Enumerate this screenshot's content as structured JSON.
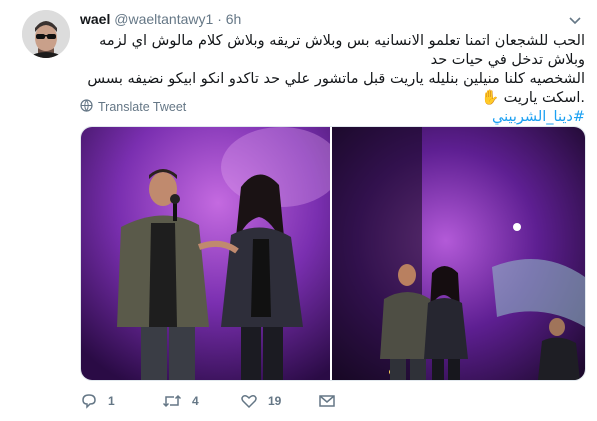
{
  "tweet": {
    "display_name": "wael",
    "handle": "@waeltantawy1",
    "separator": "·",
    "time": "6h",
    "text_line1": "الحب للشجعان اتمنا تعلمو الانسانيه بس وبلاش تريقه وبلاش كلام مالوش اي لزمه وبلاش تدخل في حيات حد",
    "text_line2": "الشخصيه كلنا منيلين بنليله ياريت قبل ماتشور علي حد تاكدو انكو ابيكو نضيفه بسس .اسكت ياريت",
    "hashtag": "#دينا_الشربيني",
    "emoji": "✋",
    "translate_label": "Translate Tweet",
    "replies": "1",
    "retweets": "4",
    "likes": "19"
  },
  "icons": {
    "more": "chevron-down-icon",
    "translate": "globe-icon",
    "reply": "reply-icon",
    "retweet": "retweet-icon",
    "like": "heart-icon",
    "dm": "envelope-icon"
  },
  "colors": {
    "link": "#1da1f2",
    "muted": "#657786",
    "stage_purple": "#7a2fb0"
  }
}
